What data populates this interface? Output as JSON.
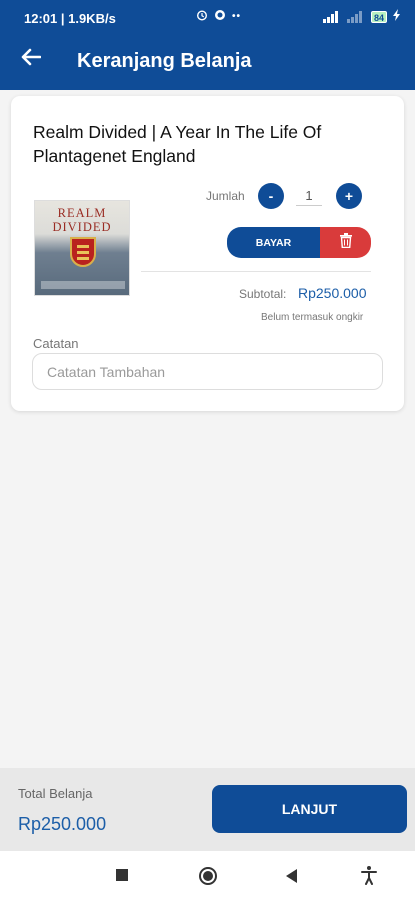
{
  "status": {
    "time_speed": "12:01 | 1.9KB/s",
    "battery": "84",
    "icons": [
      "alarm-icon",
      "whatsapp-icon",
      "more-icon",
      "signal-icon",
      "battery-icon",
      "charging-icon"
    ]
  },
  "header": {
    "title": "Keranjang Belanja",
    "back_icon": "arrow-left-icon"
  },
  "cart_item": {
    "title": "Realm Divided | A Year In The Life Of Plantagenet England",
    "cover_text_line1": "REALM",
    "cover_text_line2": "DIVIDED",
    "jumlah_label": "Jumlah",
    "minus_label": "-",
    "plus_label": "+",
    "quantity": "1",
    "bayar_label": "BAYAR",
    "subtotal_label": "Subtotal:",
    "subtotal_value": "Rp250.000",
    "ongkir_note": "Belum termasuk ongkir",
    "catatan_label": "Catatan",
    "catatan_placeholder": "Catatan Tambahan",
    "catatan_value": ""
  },
  "footer": {
    "total_label": "Total Belanja",
    "total_value": "Rp250.000",
    "lanjut_label": "LANJUT"
  },
  "colors": {
    "primary": "#0f4c97",
    "price": "#1c5ea8",
    "danger": "#d93b3b",
    "background": "#f4f4f4"
  }
}
